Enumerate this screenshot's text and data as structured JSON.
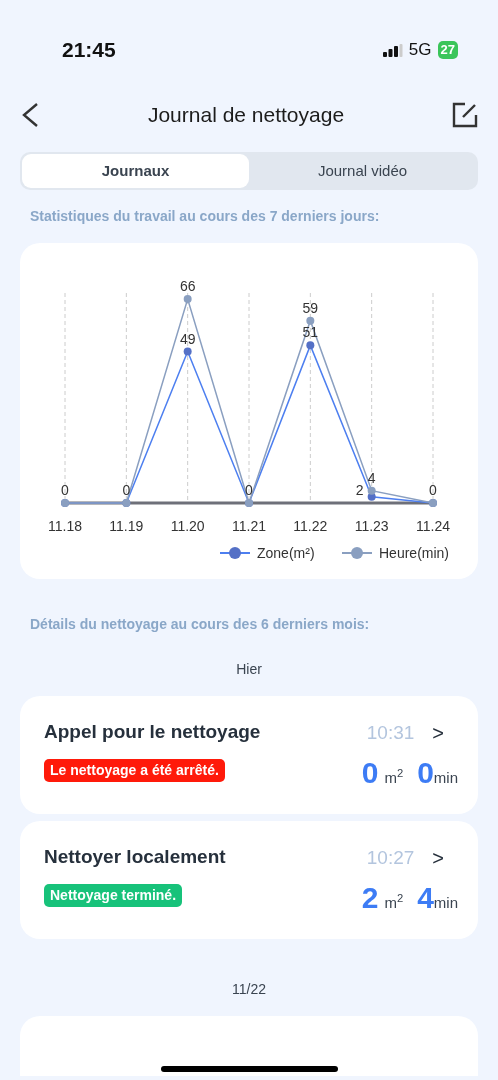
{
  "status_bar": {
    "time": "21:45",
    "network": "5G",
    "battery": "27"
  },
  "header": {
    "title": "Journal de nettoyage"
  },
  "tabs": [
    {
      "label": "Journaux",
      "selected": true
    },
    {
      "label": "Journal vidéo",
      "selected": false
    }
  ],
  "stats": {
    "heading": "Statistiques du travail au cours des 7 derniers jours:",
    "chart_data": {
      "type": "line",
      "categories": [
        "11.18",
        "11.19",
        "11.20",
        "11.21",
        "11.22",
        "11.23",
        "11.24"
      ],
      "grid": true,
      "legend": "bottom-right",
      "series": [
        {
          "name": "Zone(m²)",
          "color": "#5470c6",
          "marker": "circle",
          "values": [
            0,
            0,
            49,
            0,
            51,
            2,
            0
          ],
          "value_labels": [
            null,
            null,
            "49",
            null,
            "51",
            "2",
            null
          ]
        },
        {
          "name": "Heure(min)",
          "color": "#8a9fc0",
          "marker": "circle",
          "values": [
            0,
            0,
            66,
            0,
            59,
            4,
            0
          ],
          "value_labels": [
            "0",
            "0",
            "66",
            "0",
            "59",
            "4",
            "0"
          ]
        }
      ]
    }
  },
  "details": {
    "heading": "Détails du nettoyage au cours des 6 derniers mois:",
    "groups": [
      {
        "date": "Hier",
        "entries": [
          {
            "title": "Appel pour le nettoyage",
            "status": "Le nettoyage a été arrêté.",
            "color": "#ff1a0a",
            "time": "10:31",
            "chevron": ">",
            "area": "0",
            "area_unit": "m$^{2}$",
            "duration": "0",
            "duration_unit": "min"
          },
          {
            "title": "Nettoyer localement",
            "status": "Nettoyage terminé.",
            "color": "#17c27a",
            "time": "10:27",
            "chevron": ">",
            "area": "2",
            "area_unit": "m$^{2}$",
            "duration": "4",
            "duration_unit": "min"
          }
        ]
      },
      {
        "date": "11/22"
      }
    ]
  }
}
